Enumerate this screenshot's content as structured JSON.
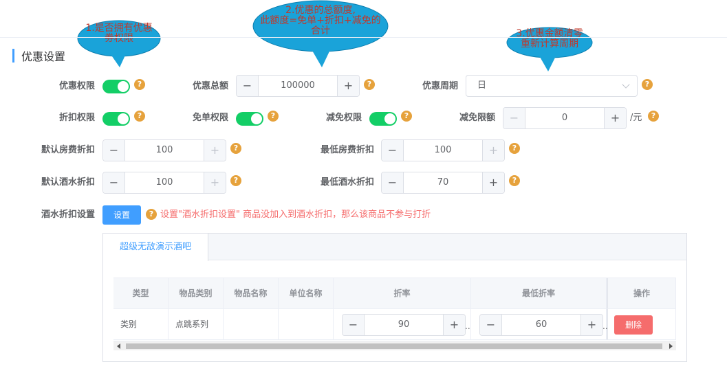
{
  "callouts": [
    {
      "text": "1.是否拥有优惠\n券权限"
    },
    {
      "text": "2.优惠的总额度,\n此额度=免单+折扣+减免的\n合计"
    },
    {
      "text": "3.优惠金额清零\n重新计算周期"
    }
  ],
  "section_title": "优惠设置",
  "help_glyph": "?",
  "form": {
    "discount_permission": {
      "label": "优惠权限",
      "on": true
    },
    "discount_total": {
      "label": "优惠总额",
      "value": "100000",
      "minus": "−",
      "plus": "+"
    },
    "discount_period": {
      "label": "优惠周期",
      "value": "日"
    },
    "rebate_permission": {
      "label": "折扣权限",
      "on": true
    },
    "free_permission": {
      "label": "免单权限",
      "on": true
    },
    "reduce_permission": {
      "label": "减免权限",
      "on": true
    },
    "reduce_limit": {
      "label": "减免限额",
      "value": "0",
      "unit": "/元",
      "minus": "−",
      "plus": "+"
    },
    "default_room_rebate": {
      "label": "默认房费折扣",
      "value": "100",
      "minus": "−",
      "plus": "+"
    },
    "min_room_rebate": {
      "label": "最低房费折扣",
      "value": "100",
      "minus": "−",
      "plus": "+"
    },
    "default_drink_rebate": {
      "label": "默认酒水折扣",
      "value": "100",
      "minus": "−",
      "plus": "+"
    },
    "min_drink_rebate": {
      "label": "最低酒水折扣",
      "value": "70",
      "minus": "−",
      "plus": "+"
    },
    "drink_rebate_setting": {
      "label": "酒水折扣设置",
      "button": "设置",
      "warning": "设置\"酒水折扣设置\" 商品没加入到酒水折扣，那么该商品不参与打折"
    }
  },
  "tabs": [
    {
      "label": "超级无敌演示酒吧",
      "active": true
    }
  ],
  "table": {
    "headers": [
      "类型",
      "物品类别",
      "物品名称",
      "单位名称",
      "折率",
      "最低折率",
      "操作"
    ],
    "rows": [
      {
        "type": "类别",
        "category": "点跳系列",
        "name": "",
        "unit": "",
        "rate": "90",
        "min_rate": "60",
        "action": "删除"
      }
    ],
    "ellipsis": "..",
    "minus": "−",
    "plus": "+"
  },
  "colors": {
    "accent": "#409eff",
    "switch_on": "#13ce66",
    "help": "#e6a23c",
    "danger": "#f56c6c",
    "callout_fill": "#1aa3d9"
  }
}
